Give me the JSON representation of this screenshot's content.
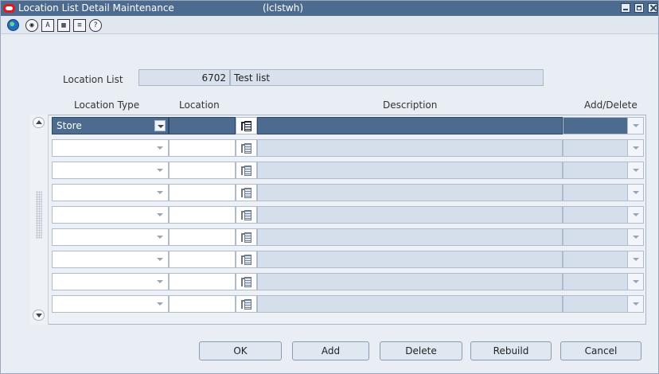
{
  "window": {
    "title": "Location List Detail Maintenance",
    "module": "(lclstwh)"
  },
  "toolbar": {
    "icons": [
      "globe-icon",
      "help-icon",
      "context-icon",
      "calendar-icon",
      "notepad-icon",
      "question-icon"
    ],
    "labels": [
      "◉",
      "A",
      "▦",
      "≡",
      "?"
    ]
  },
  "header": {
    "location_list_label": "Location List",
    "location_list_value": "6702",
    "location_list_desc": "Test list"
  },
  "grid": {
    "columns": [
      "Location Type",
      "Location",
      "Description",
      "Add/Delete"
    ],
    "rows": [
      {
        "type": "Store",
        "location": "",
        "description": "",
        "add_delete": ""
      },
      {
        "type": "",
        "location": "",
        "description": "",
        "add_delete": ""
      },
      {
        "type": "",
        "location": "",
        "description": "",
        "add_delete": ""
      },
      {
        "type": "",
        "location": "",
        "description": "",
        "add_delete": ""
      },
      {
        "type": "",
        "location": "",
        "description": "",
        "add_delete": ""
      },
      {
        "type": "",
        "location": "",
        "description": "",
        "add_delete": ""
      },
      {
        "type": "",
        "location": "",
        "description": "",
        "add_delete": ""
      },
      {
        "type": "",
        "location": "",
        "description": "",
        "add_delete": ""
      },
      {
        "type": "",
        "location": "",
        "description": "",
        "add_delete": ""
      }
    ]
  },
  "buttons": {
    "ok": "OK",
    "add": "Add",
    "delete": "Delete",
    "rebuild": "Rebuild",
    "cancel": "Cancel"
  },
  "colors": {
    "titlebar": "#4d6b8f",
    "selection": "#4d6b8f",
    "readonly_cell": "#d5dfec",
    "logo": "#e8141c"
  }
}
